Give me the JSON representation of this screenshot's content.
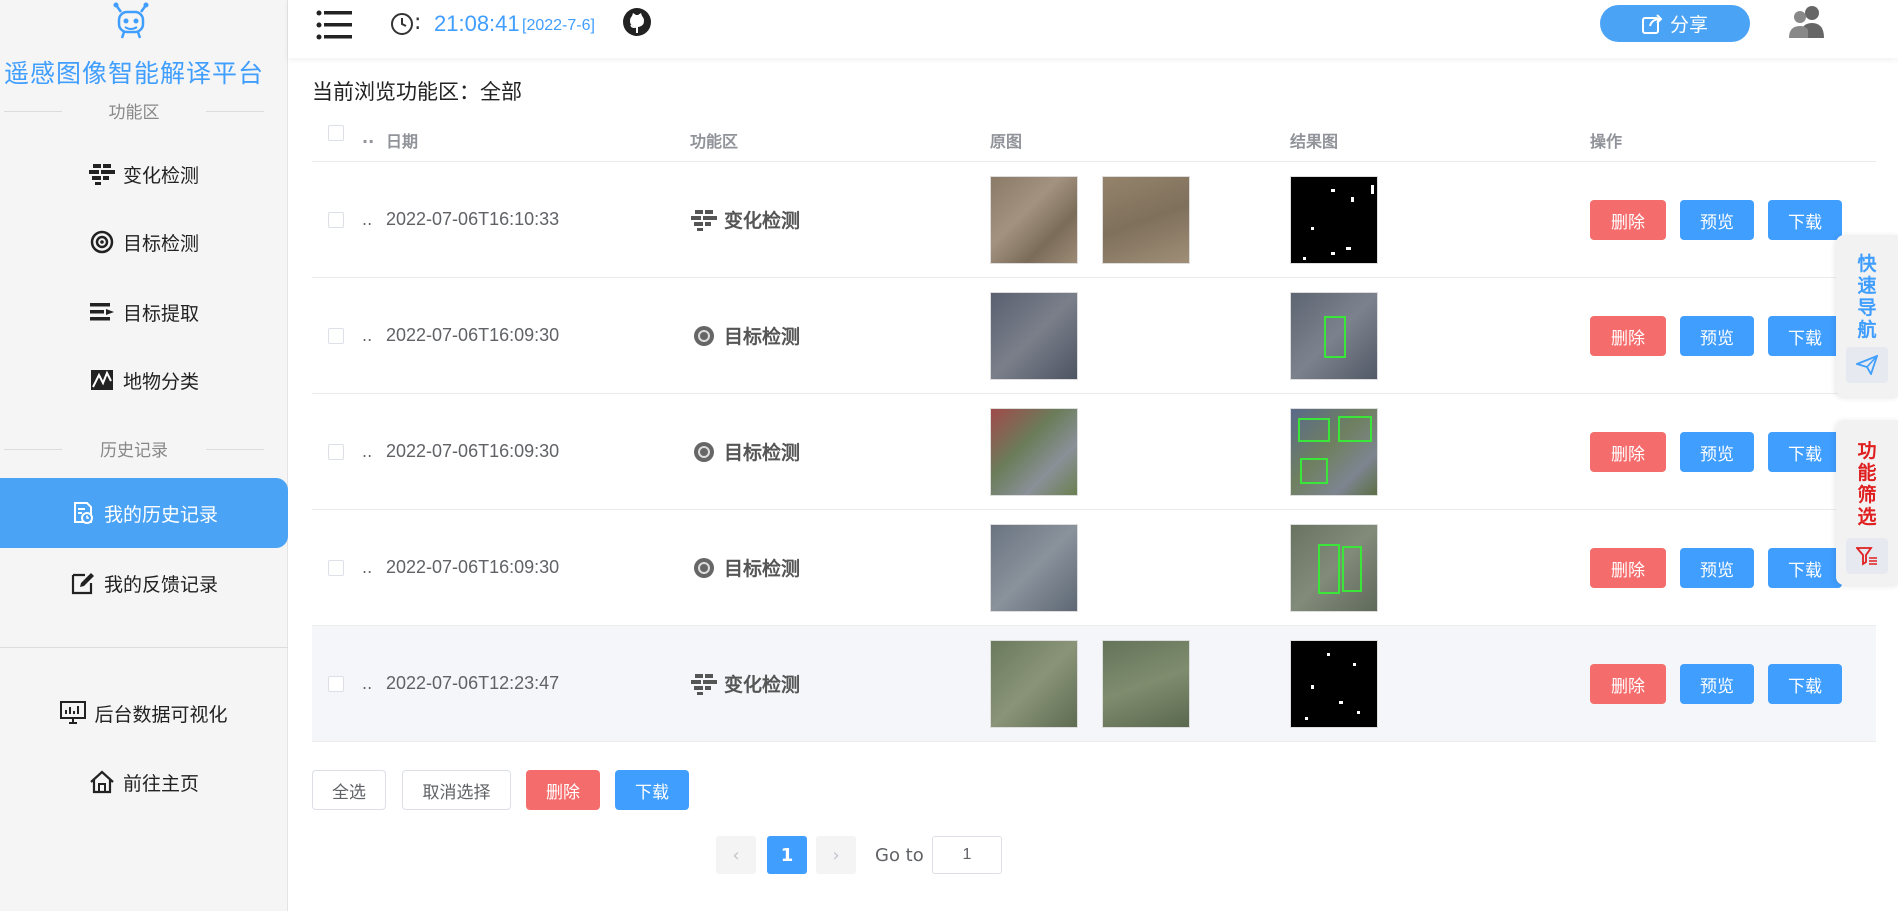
{
  "app": {
    "title": "遥感图像智能解译平台",
    "section_functions": "功能区",
    "section_history": "历史记录"
  },
  "sidebar": {
    "functions": [
      {
        "label": "变化检测",
        "icon": "change-detection-icon"
      },
      {
        "label": "目标检测",
        "icon": "target-detection-icon"
      },
      {
        "label": "目标提取",
        "icon": "target-extraction-icon"
      },
      {
        "label": "地物分类",
        "icon": "land-classification-icon"
      }
    ],
    "history": [
      {
        "label": "我的历史记录",
        "icon": "history-doc-icon",
        "active": true
      },
      {
        "label": "我的反馈记录",
        "icon": "feedback-edit-icon",
        "active": false
      }
    ],
    "bottom": [
      {
        "label": "后台数据可视化",
        "icon": "dashboard-monitor-icon"
      },
      {
        "label": "前往主页",
        "icon": "home-icon"
      }
    ]
  },
  "topbar": {
    "colon": ":",
    "time": "21:08:41",
    "date": "[2022-7-6]",
    "share_label": "分享"
  },
  "main": {
    "title_prefix": "当前浏览功能区：",
    "title_value": "全部",
    "columns": {
      "dots": "..",
      "date": "日期",
      "function": "功能区",
      "original": "原图",
      "result": "结果图",
      "actions": "操作"
    },
    "rows": [
      {
        "dots": "..",
        "date": "2022-07-06T16:10:33",
        "function": "变化检测",
        "func_icon": "change-detection-icon",
        "original_count": 2,
        "result_type": "binary-mask"
      },
      {
        "dots": "..",
        "date": "2022-07-06T16:09:30",
        "function": "目标检测",
        "func_icon": "target-detection-icon",
        "original_count": 1,
        "result_type": "detection"
      },
      {
        "dots": "..",
        "date": "2022-07-06T16:09:30",
        "function": "目标检测",
        "func_icon": "target-detection-icon",
        "original_count": 1,
        "result_type": "detection"
      },
      {
        "dots": "..",
        "date": "2022-07-06T16:09:30",
        "function": "目标检测",
        "func_icon": "target-detection-icon",
        "original_count": 1,
        "result_type": "detection"
      },
      {
        "dots": "..",
        "date": "2022-07-06T12:23:47",
        "function": "变化检测",
        "func_icon": "change-detection-icon",
        "original_count": 2,
        "result_type": "binary-mask"
      }
    ],
    "row_actions": {
      "delete": "删除",
      "preview": "预览",
      "download": "下载"
    },
    "bulk": {
      "select_all": "全选",
      "cancel_selection": "取消选择",
      "delete": "删除",
      "download": "下载"
    },
    "pagination": {
      "prev": "‹",
      "current": "1",
      "next": "›",
      "goto_label": "Go to",
      "goto_value": "1"
    }
  },
  "float": {
    "quick_nav": "快速导航",
    "filter": "功能筛选"
  },
  "colors": {
    "primary": "#409eff",
    "danger": "#f56c6c",
    "filter_red": "#e02020"
  }
}
